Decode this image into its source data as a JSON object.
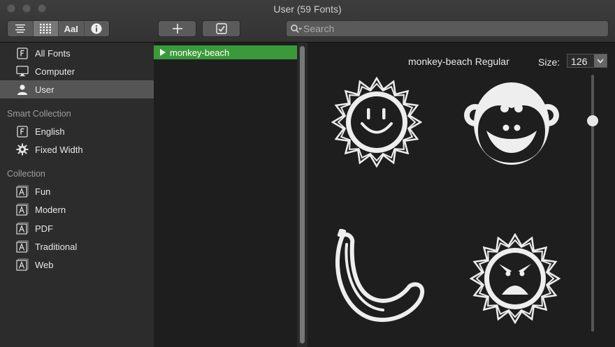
{
  "window": {
    "title": "User (59 Fonts)"
  },
  "toolbar": {
    "aa_label": "AaI",
    "search_placeholder": "Search"
  },
  "sidebar": {
    "library_items": [
      {
        "label": "All Fonts",
        "icon": "font-file-icon"
      },
      {
        "label": "Computer",
        "icon": "monitor-icon"
      },
      {
        "label": "User",
        "icon": "user-icon",
        "selected": true
      }
    ],
    "smart_collection_header": "Smart Collection",
    "smart_items": [
      {
        "label": "English",
        "icon": "font-file-icon"
      },
      {
        "label": "Fixed Width",
        "icon": "gear-icon"
      }
    ],
    "collection_header": "Collection",
    "collection_items": [
      {
        "label": "Fun",
        "icon": "font-collection-icon"
      },
      {
        "label": "Modern",
        "icon": "font-collection-icon"
      },
      {
        "label": "PDF",
        "icon": "font-collection-icon"
      },
      {
        "label": "Traditional",
        "icon": "font-collection-icon"
      },
      {
        "label": "Web",
        "icon": "font-collection-icon"
      }
    ]
  },
  "font_list": {
    "items": [
      {
        "label": "monkey-beach",
        "selected": true
      }
    ]
  },
  "preview": {
    "font_name": "monkey-beach Regular",
    "size_label": "Size:",
    "size_value": "126",
    "slider_fraction": 0.18,
    "glyphs": [
      "smiling-sun",
      "monkey-face",
      "banana",
      "angry-sun"
    ]
  },
  "colors": {
    "selection_green": "#3a9a3a",
    "sidebar_bg": "#2c2c2c",
    "content_bg": "#1e1e1e"
  }
}
